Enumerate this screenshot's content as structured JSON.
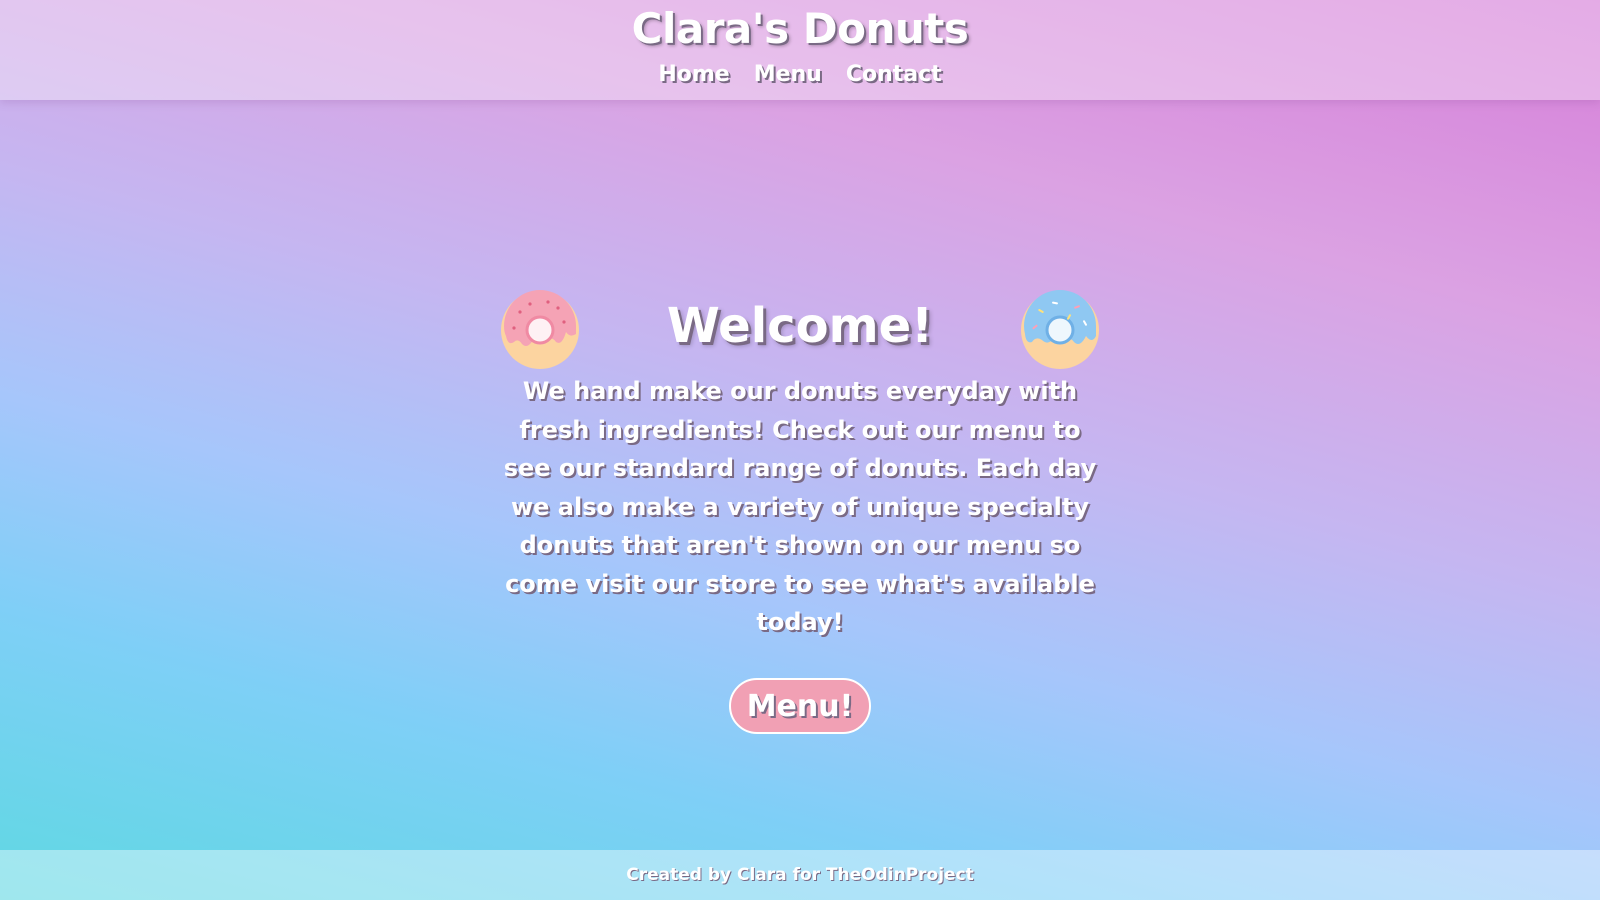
{
  "header": {
    "brand": "Clara's Donuts",
    "nav": [
      "Home",
      "Menu",
      "Contact"
    ]
  },
  "hero": {
    "title": "Welcome!",
    "intro": "We hand make our donuts everyday with fresh ingredients! Check out our menu to see our standard range of donuts. Each day we also make a variety of unique specialty donuts that aren't shown on our menu so come visit our store to see what's available today!",
    "button_label": "Menu!",
    "left_icon": "pink-donut-icon",
    "right_icon": "blue-donut-icon"
  },
  "footer": {
    "credit": "Created by Clara for TheOdinProject"
  },
  "colors": {
    "button": "#f1a0b4",
    "pink_frosting": "#f5a3b5",
    "blue_frosting": "#8fc8f2",
    "dough": "#fcd4a0"
  }
}
